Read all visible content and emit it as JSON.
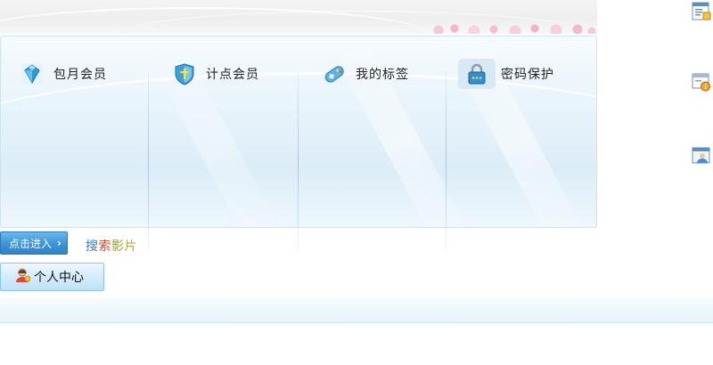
{
  "cards": [
    {
      "label": "包月会员",
      "icon": "diamond-icon"
    },
    {
      "label": "计点会员",
      "icon": "shield-icon"
    },
    {
      "label": "我的标签",
      "icon": "gamepad-icon"
    },
    {
      "label": "密码保护",
      "icon": "lock-icon"
    }
  ],
  "side_icons": [
    "document-list-icon",
    "window-coin-icon",
    "user-card-icon"
  ],
  "enter_button": {
    "label": "点击进入",
    "arrow": "›"
  },
  "search_link": {
    "c1": "搜",
    "c2": "索",
    "c3": "影",
    "c4": "片"
  },
  "personal_button": {
    "label": "个人中心",
    "icon": "user-icon"
  },
  "colors": {
    "accent": "#3d93d8",
    "panel_bg": "#e9f4fb"
  }
}
